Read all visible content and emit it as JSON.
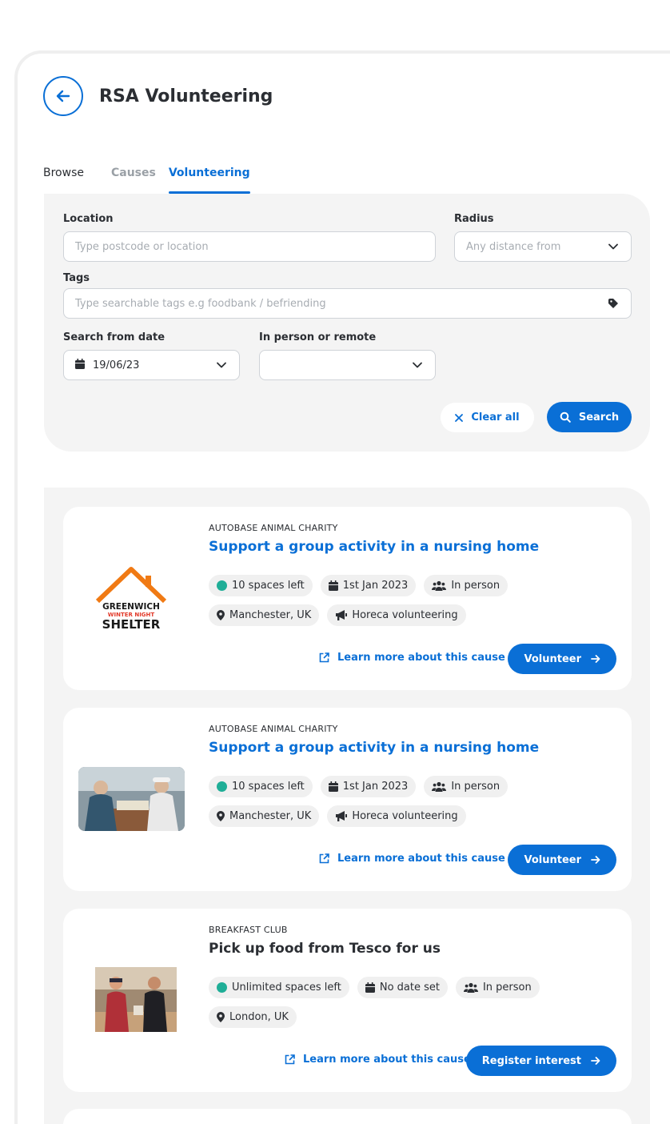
{
  "header": {
    "title": "RSA Volunteering"
  },
  "tabs": [
    {
      "label": "Browse"
    },
    {
      "label": "Causes"
    },
    {
      "label": "Volunteering"
    }
  ],
  "filters": {
    "location_label": "Location",
    "location_placeholder": "Type postcode or location",
    "radius_label": "Radius",
    "radius_placeholder": "Any distance from",
    "tags_label": "Tags",
    "tags_placeholder": "Type searchable tags e.g foodbank / befriending",
    "date_label": "Search from date",
    "date_value": "19/06/23",
    "mode_label": "In person or remote",
    "mode_value": "",
    "clear_label": "Clear all",
    "search_label": "Search"
  },
  "results": [
    {
      "org": "AUTOBASE ANIMAL CHARITY",
      "title": "Support a group activity in a nursing home",
      "spaces": "10 spaces left",
      "date": "1st Jan 2023",
      "mode": "In person",
      "location": "Manchester, UK",
      "category": "Horeca volunteering",
      "learn_more": "Learn more about this cause",
      "cta": "Volunteer",
      "logo": {
        "line1": "GREENWICH",
        "line2": "WINTER NIGHT",
        "line3": "SHELTER"
      }
    },
    {
      "org": "AUTOBASE ANIMAL CHARITY",
      "title": "Support a group activity in a nursing home",
      "spaces": "10 spaces left",
      "date": "1st Jan 2023",
      "mode": "In person",
      "location": "Manchester, UK",
      "category": "Horeca volunteering",
      "learn_more": "Learn more about this cause",
      "cta": "Volunteer"
    },
    {
      "org": "BREAKFAST CLUB",
      "title": "Pick up food from Tesco for us",
      "spaces": "Unlimited spaces left",
      "date": "No date set",
      "mode": "In person",
      "location": "London, UK",
      "learn_more": "Learn more about this cause",
      "cta": "Register interest"
    }
  ],
  "colors": {
    "accent": "#0a6fd6",
    "available": "#1fae97",
    "panel": "#f4f4f4"
  }
}
